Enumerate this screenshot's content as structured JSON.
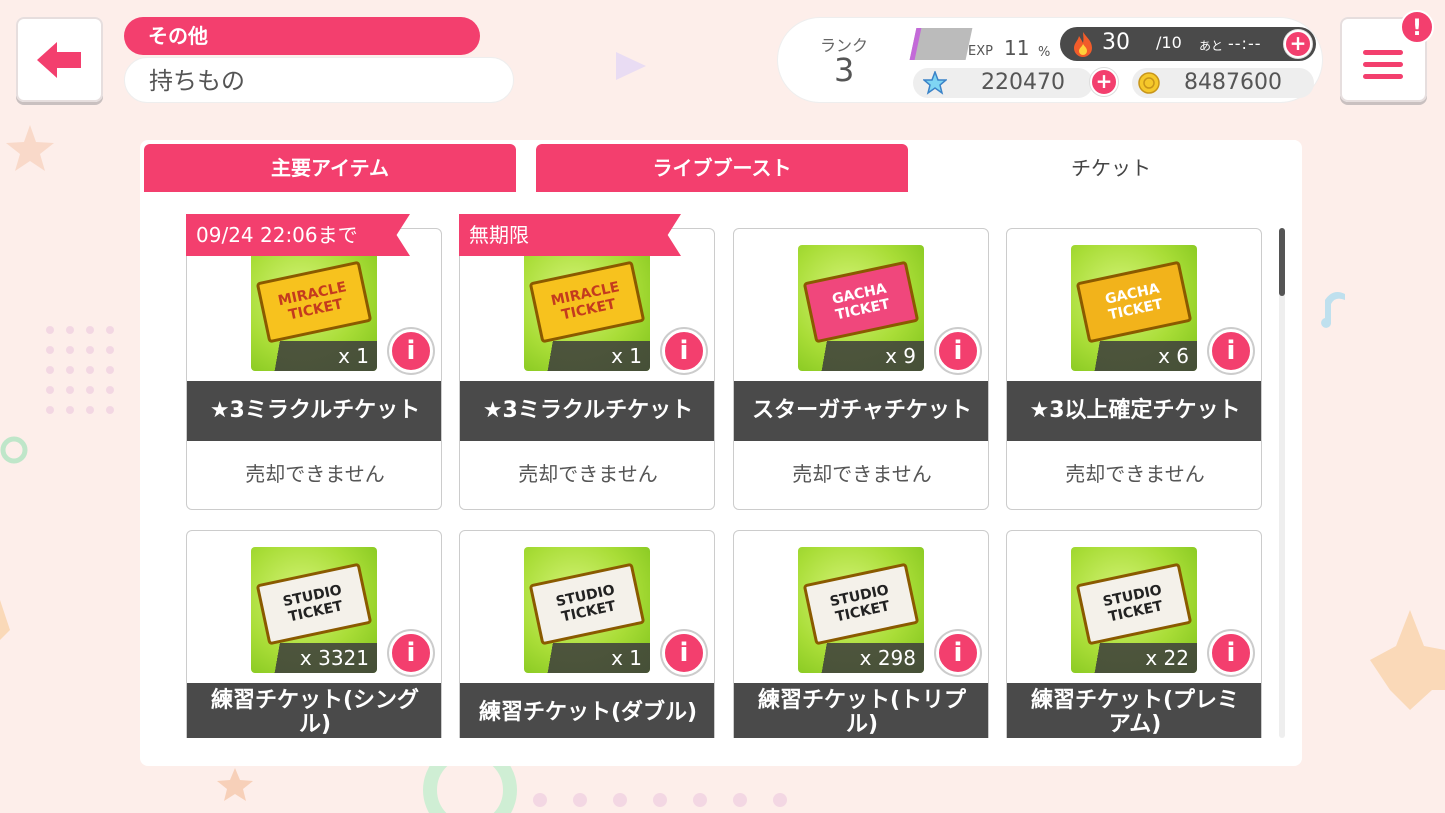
{
  "header": {
    "category": "その他",
    "title": "持ちもの"
  },
  "status": {
    "rank_label": "ランク",
    "rank_value": "3",
    "exp_label": "EXP",
    "exp_value": "11",
    "exp_unit": "%",
    "exp_fraction": 0.11,
    "live_points": "30",
    "live_points_max": "/10",
    "remaining_label": "あと",
    "remaining_time": "--:--",
    "star_gems": "220470",
    "coins": "8487600"
  },
  "tabs": [
    {
      "label": "主要アイテム",
      "active": false
    },
    {
      "label": "ライブブースト",
      "active": false
    },
    {
      "label": "チケット",
      "active": true
    }
  ],
  "items": [
    {
      "name": "★3ミラクルチケット",
      "count": "x 1",
      "sell": "売却できません",
      "ribbon": "09/24 22:06まで",
      "ticket_text": [
        "MIRACLE",
        "TICKET"
      ],
      "ticket_color": "#f7c21e",
      "ticket_text_color": "#c43b1e"
    },
    {
      "name": "★3ミラクルチケット",
      "count": "x 1",
      "sell": "売却できません",
      "ribbon": "無期限",
      "ticket_text": [
        "MIRACLE",
        "TICKET"
      ],
      "ticket_color": "#f7c21e",
      "ticket_text_color": "#c43b1e"
    },
    {
      "name": "スターガチャチケット",
      "count": "x 9",
      "sell": "売却できません",
      "ribbon": "",
      "ticket_text": [
        "GACHA",
        "TICKET"
      ],
      "ticket_color": "#f0477c",
      "ticket_text_color": "#ffffff"
    },
    {
      "name": "★3以上確定チケット",
      "count": "x 6",
      "sell": "売却できません",
      "ribbon": "",
      "ticket_text": [
        "GACHA",
        "TICKET"
      ],
      "ticket_color": "#f2b31b",
      "ticket_text_color": "#ffffff"
    },
    {
      "name": "練習チケット(シングル)",
      "count": "x 3321",
      "sell": "",
      "ribbon": "",
      "ticket_text": [
        "STUDIO",
        "TICKET"
      ],
      "ticket_color": "#f4f1ea",
      "ticket_text_color": "#222222"
    },
    {
      "name": "練習チケット(ダブル)",
      "count": "x 1",
      "sell": "",
      "ribbon": "",
      "ticket_text": [
        "STUDIO",
        "TICKET"
      ],
      "ticket_color": "#f4f1ea",
      "ticket_text_color": "#222222"
    },
    {
      "name": "練習チケット(トリプル)",
      "count": "x 298",
      "sell": "",
      "ribbon": "",
      "ticket_text": [
        "STUDIO",
        "TICKET"
      ],
      "ticket_color": "#f4f1ea",
      "ticket_text_color": "#222222"
    },
    {
      "name": "練習チケット(プレミアム)",
      "count": "x 22",
      "sell": "",
      "ribbon": "",
      "ticket_text": [
        "STUDIO",
        "TICKET"
      ],
      "ticket_color": "#f4f1ea",
      "ticket_text_color": "#222222"
    }
  ],
  "icons": {
    "back": "arrow-left-icon",
    "menu": "hamburger-menu-icon",
    "info": "i",
    "notification": "!",
    "plus": "+"
  },
  "colors": {
    "accent": "#f33f6e",
    "dark_bar": "#4a4a4a",
    "background": "#fdeeea"
  }
}
